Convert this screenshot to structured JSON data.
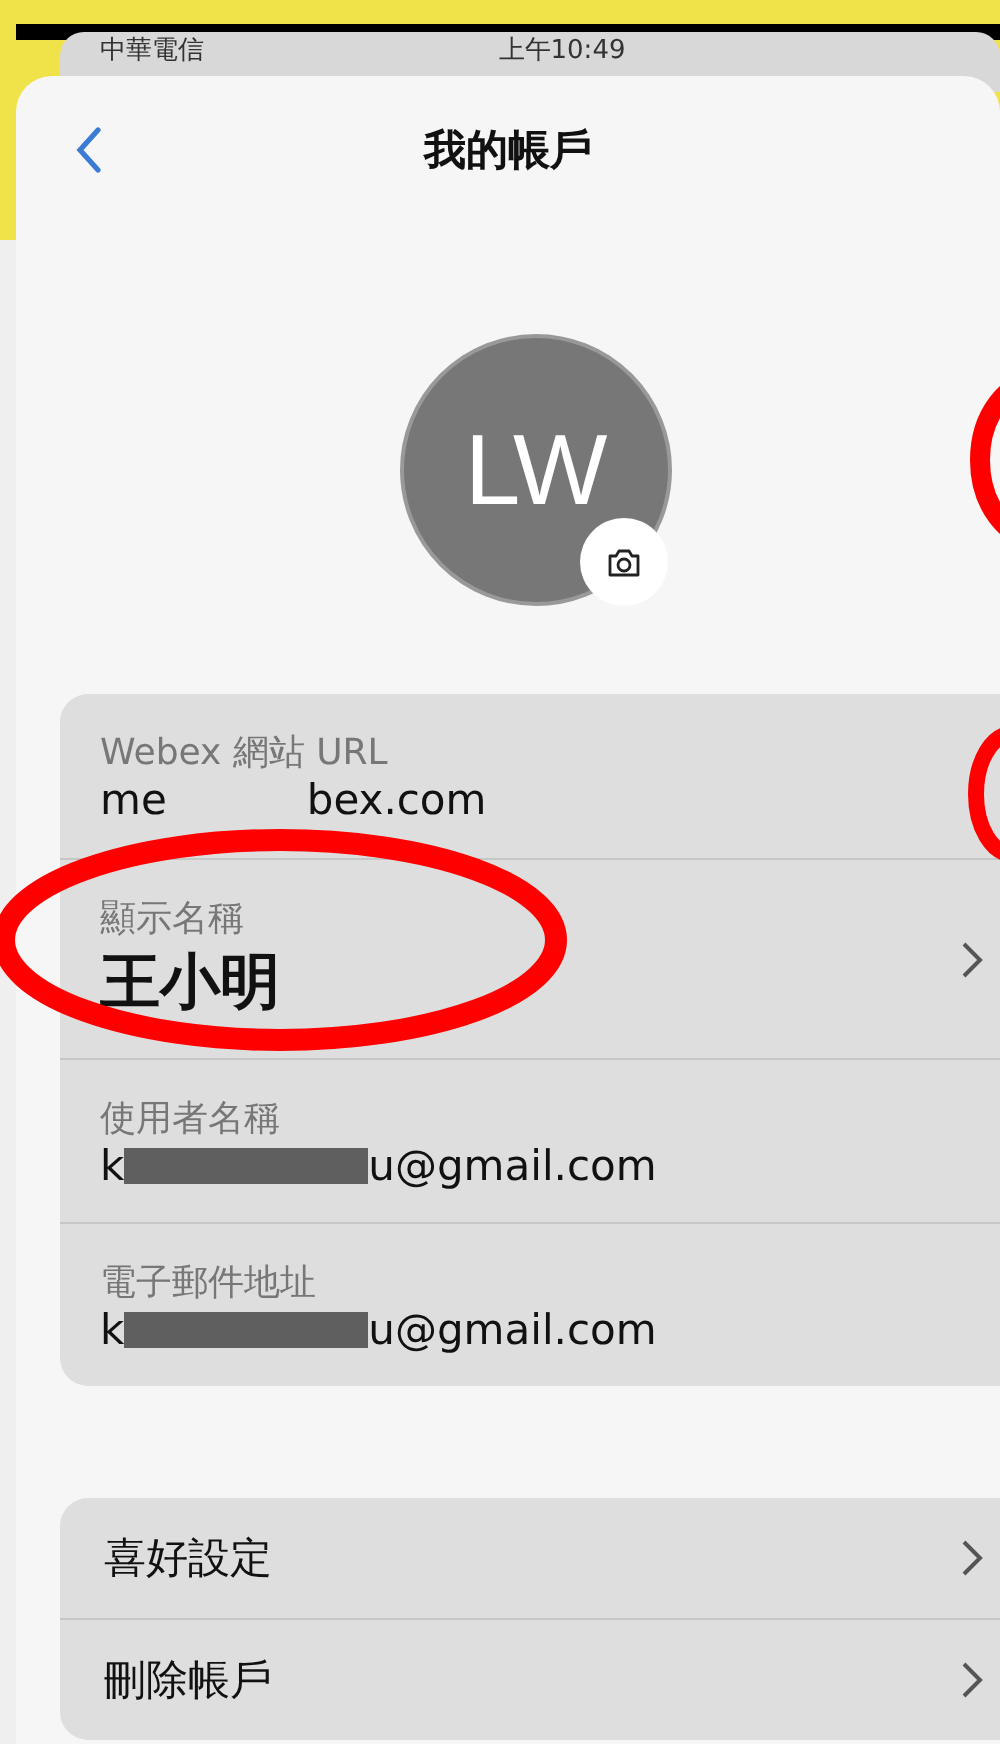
{
  "status_bar": {
    "carrier": "中華電信",
    "time": "上午10:49"
  },
  "nav": {
    "title": "我的帳戶"
  },
  "avatar": {
    "initials": "LW"
  },
  "account_fields": [
    {
      "kind": "partial",
      "label": "Webex 網站 URL",
      "value_start": "me",
      "value_end": "bex.com",
      "chevron": false
    },
    {
      "kind": "name",
      "label": "顯示名稱",
      "value": "王小明",
      "chevron": true
    },
    {
      "kind": "redacted",
      "label": "使用者名稱",
      "value_start": "k",
      "value_end": "u@gmail.com",
      "chevron": false
    },
    {
      "kind": "redacted",
      "label": "電子郵件地址",
      "value_start": "k",
      "value_end": "u@gmail.com",
      "chevron": false
    }
  ],
  "menu_items": [
    {
      "label": "喜好設定"
    },
    {
      "label": "刪除帳戶"
    }
  ]
}
